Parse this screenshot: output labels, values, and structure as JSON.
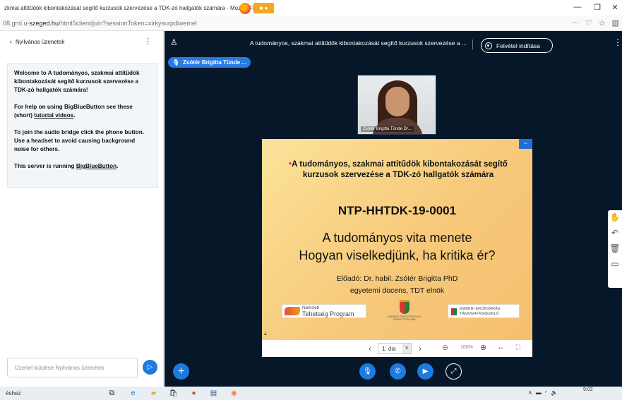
{
  "browser": {
    "window_title": "zkmai attitűdök kibontakozását segítő kurzusok szervezése a TDK-zó hallgatók számára - Mozilla Fi",
    "url_prefix": "08.gml.u-",
    "url_host": "szeged.hu",
    "url_rest": "/html5client/join?sessionToken=xirkysurpdlwemel",
    "minimize": "—",
    "maximize": "❐",
    "close": "✕"
  },
  "chat": {
    "header_title": "Nyilvános üzenetek",
    "welcome_line1": "Welcome to A tudományos, szakmai attitűdök kibontakozását segítő kurzusok szervezése a TDK-zó hallgatók számára!",
    "help_text_before": "For help on using BigBlueButton see these (short) ",
    "help_link": "tutorial videos",
    "help_text_after": ".",
    "audio_text": "To join the audio bridge click the phone button. Use a headset to avoid causing background noise for others.",
    "server_text_before": "This server is running ",
    "server_link": "BigBlueButton",
    "server_text_after": ".",
    "input_placeholder": "Üzenet küldése Nyilvános üzenetek"
  },
  "meeting": {
    "title": "A tudományos, szakmai attitűdök kibontakozását segítő kurzusok szervezése a ...",
    "record_label": "Felvétel indítása",
    "talker": "Zsótér Brigitta Tünde ...",
    "webcam_label": "Zsótér Brigitta Tünde Dr..."
  },
  "slide": {
    "heading": "A tudományos, szakmai attitűdök kibontakozását segítő kurzusok szervezése a TDK-zó hallgatók számára",
    "code": "NTP-HHTDK-19-0001",
    "subtitle1": "A tudományos vita menete",
    "subtitle2": "Hogyan viselkedjünk, ha kritika ér?",
    "presenter1": "Előadó: Dr. habil. Zsótér Brigitta PhD",
    "presenter2": "egyetemi docens, TDT elnök",
    "logo_ntp_line1": "Nemzeti",
    "logo_ntp_line2": "Tehetség Program",
    "logo_crest_text": "EMBERI ERŐFORRÁSOK MINISZTÉRIUMA",
    "logo_emmi": "EMBERI ERŐFORRÁS TÁMOGATÁSKEZELŐ"
  },
  "slide_controls": {
    "page": "1. dia",
    "zoom": "100%"
  },
  "taskbar": {
    "search_text": "éshez",
    "time": "9:02"
  }
}
